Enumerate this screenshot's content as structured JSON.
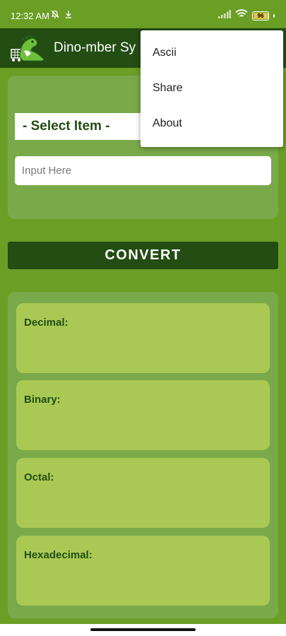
{
  "status_bar": {
    "time": "12:32 AM",
    "battery": "96",
    "battery_level": 0.96,
    "icons": [
      "mute-icon",
      "download-icon",
      "signal-icon",
      "wifi-icon",
      "battery-icon"
    ]
  },
  "app_bar": {
    "title": "Dino-mber Sy"
  },
  "converter": {
    "select_label": "- Select Item -",
    "input_placeholder": "Input Here",
    "input_value": "",
    "convert_label": "CONVERT"
  },
  "results": {
    "decimal_label": "Decimal:",
    "binary_label": "Binary:",
    "octal_label": "Octal:",
    "hexadecimal_label": "Hexadecimal:"
  },
  "menu": {
    "items": [
      {
        "label": "Ascii"
      },
      {
        "label": "Share"
      },
      {
        "label": "About"
      }
    ]
  },
  "colors": {
    "background": "#6a9e25",
    "dark_green": "#234d13",
    "card": "#7aa94a",
    "result_box": "#a9c954"
  }
}
